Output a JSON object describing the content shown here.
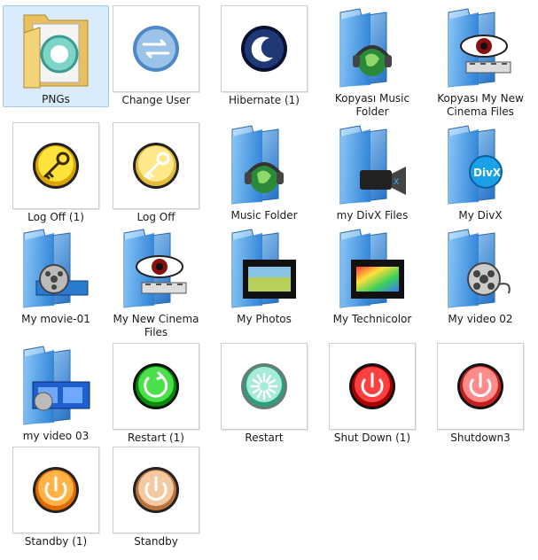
{
  "items": [
    {
      "label": "PNGs",
      "icon": "folder-icon",
      "kind": "folder-docs",
      "selected": true
    },
    {
      "label": "Change User",
      "icon": "change-user-icon",
      "kind": "arrows",
      "c1": "#9bc3e8",
      "c2": "#4f86c7"
    },
    {
      "label": "Hibernate (1)",
      "icon": "moon-icon",
      "kind": "moon",
      "c1": "#3b5fa8",
      "c2": "#0e1f55"
    },
    {
      "label": "Kopyası Music Folder",
      "icon": "music-folder-icon",
      "kind": "folder-music"
    },
    {
      "label": "Kopyası My New Cinema Files",
      "icon": "cinema-folder-icon",
      "kind": "folder-eye"
    },
    {
      "label": "Log Off (1)",
      "icon": "key-icon",
      "kind": "key",
      "c1": "#ffe23a",
      "c2": "#d9a300",
      "k": "#3a2a00"
    },
    {
      "label": "Log Off",
      "icon": "key-icon",
      "kind": "key",
      "c1": "#ffe88a",
      "c2": "#e3be3a",
      "k": "#ffffff"
    },
    {
      "label": "Music Folder",
      "icon": "music-folder-icon",
      "kind": "folder-music"
    },
    {
      "label": "my DivX Files",
      "icon": "divx-folder-icon",
      "kind": "folder-camera"
    },
    {
      "label": "My DivX",
      "icon": "divx-folder-icon",
      "kind": "folder-divx"
    },
    {
      "label": "My movie-01",
      "icon": "movie-folder-icon",
      "kind": "folder-reel"
    },
    {
      "label": "My New Cinema Files",
      "icon": "cinema-folder-icon",
      "kind": "folder-eye"
    },
    {
      "label": "My Photos",
      "icon": "photos-folder-icon",
      "kind": "folder-film"
    },
    {
      "label": "My Technicolor",
      "icon": "technicolor-folder-icon",
      "kind": "folder-rainbow"
    },
    {
      "label": "My video 02",
      "icon": "video-folder-icon",
      "kind": "folder-reel2"
    },
    {
      "label": "my video 03",
      "icon": "video-folder-icon",
      "kind": "folder-strip"
    },
    {
      "label": "Restart (1)",
      "icon": "restart-icon",
      "kind": "restart",
      "c1": "#4be04b",
      "c2": "#078a07"
    },
    {
      "label": "Restart",
      "icon": "restart-icon",
      "kind": "spinner",
      "c1": "#a6ead8",
      "c2": "#2f9c7e"
    },
    {
      "label": "Shut Down (1)",
      "icon": "power-icon",
      "kind": "power",
      "c1": "#ff4040",
      "c2": "#a80000"
    },
    {
      "label": "Shutdown3",
      "icon": "power-icon",
      "kind": "power",
      "c1": "#ff8a8a",
      "c2": "#c41e1e"
    },
    {
      "label": "Standby (1)",
      "icon": "standby-icon",
      "kind": "standby",
      "c1": "#ffb347",
      "c2": "#e06a00"
    },
    {
      "label": "Standby",
      "icon": "standby-icon",
      "kind": "standby",
      "c1": "#f2c9a0",
      "c2": "#b8743a"
    }
  ]
}
